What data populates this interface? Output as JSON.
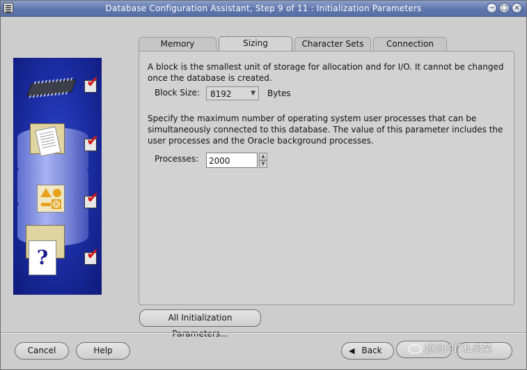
{
  "window": {
    "title": "Database Configuration Assistant, Step 9 of 11 : Initialization Parameters"
  },
  "tabs": [
    {
      "label": "Memory",
      "active": false
    },
    {
      "label": "Sizing",
      "active": true
    },
    {
      "label": "Character Sets",
      "active": false
    },
    {
      "label": "Connection Mode",
      "active": false
    }
  ],
  "sizing": {
    "block_description": "A block is the smallest unit of storage for allocation and for I/O. It cannot be changed once the database is created.",
    "block_size_label": "Block Size:",
    "block_size_value": "8192",
    "block_size_unit": "Bytes",
    "processes_description": "Specify the maximum number of operating system user processes that can be simultaneously connected to this database. The value of this parameter includes the user processes and the Oracle background processes.",
    "processes_label": "Processes:",
    "processes_value": "2000"
  },
  "buttons": {
    "all_params": "All Initialization Parameters...",
    "cancel": "Cancel",
    "help": "Help",
    "back": "Back"
  },
  "side_icons": [
    "memory-chip-icon",
    "documents-folder-icon",
    "shapes-icon",
    "help-document-icon"
  ],
  "watermark": "超哥的IT私房菜",
  "colors": {
    "title_bar": "#5f77ad",
    "side_panel": "#1d2fa7",
    "check_mark": "#d21a1a"
  }
}
